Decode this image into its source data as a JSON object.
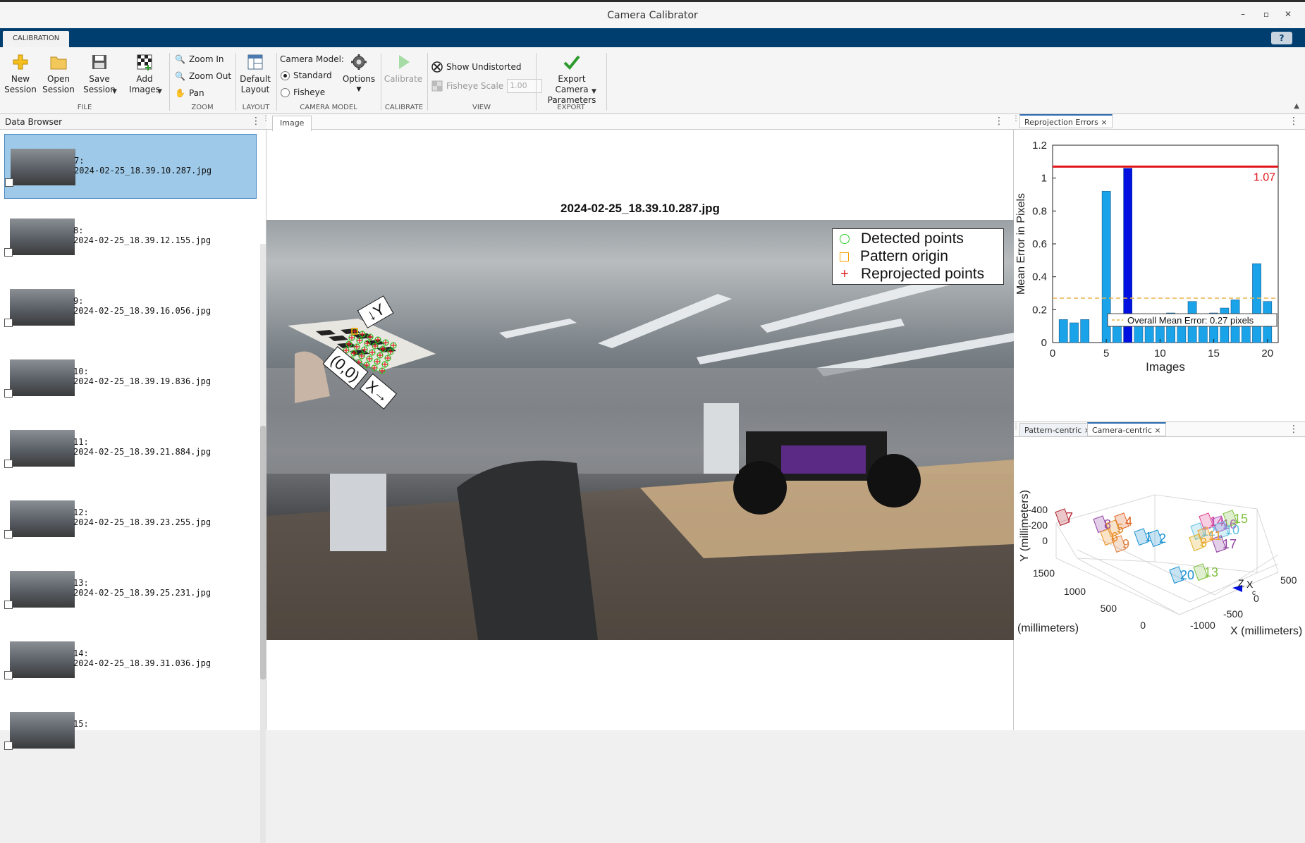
{
  "window": {
    "title": "Camera Calibrator",
    "min": "–",
    "restore": "▫",
    "close": "✕"
  },
  "ribbon": {
    "tab": "CALIBRATION",
    "help": "?",
    "file": {
      "label": "FILE",
      "new": "New\nSession",
      "open": "Open\nSession",
      "save": "Save\nSession",
      "add": "Add\nImages"
    },
    "zoom": {
      "label": "ZOOM",
      "zoom_in": "Zoom In",
      "zoom_out": "Zoom Out",
      "pan": "Pan"
    },
    "layout": {
      "label": "LAYOUT",
      "default": "Default\nLayout"
    },
    "camera_model": {
      "label": "CAMERA MODEL",
      "title": "Camera Model:",
      "standard": "Standard",
      "fisheye": "Fisheye",
      "options": "Options",
      "selected": "Standard"
    },
    "calibrate": {
      "label": "CALIBRATE",
      "button": "Calibrate"
    },
    "view": {
      "label": "VIEW",
      "show_undistorted": "Show Undistorted",
      "fisheye_scale": "Fisheye Scale",
      "fisheye_scale_value": "1.00"
    },
    "export": {
      "label": "EXPORT",
      "button": "Export Camera\nParameters"
    }
  },
  "data_browser": {
    "title": "Data Browser",
    "items": [
      {
        "index": "7:",
        "file": "2024-02-25_18.39.10.287.jpg",
        "selected": true
      },
      {
        "index": "8:",
        "file": "2024-02-25_18.39.12.155.jpg"
      },
      {
        "index": "9:",
        "file": "2024-02-25_18.39.16.056.jpg"
      },
      {
        "index": "10:",
        "file": "2024-02-25_18.39.19.836.jpg"
      },
      {
        "index": "11:",
        "file": "2024-02-25_18.39.21.884.jpg"
      },
      {
        "index": "12:",
        "file": "2024-02-25_18.39.23.255.jpg"
      },
      {
        "index": "13:",
        "file": "2024-02-25_18.39.25.231.jpg"
      },
      {
        "index": "14:",
        "file": "2024-02-25_18.39.31.036.jpg"
      },
      {
        "index": "15:",
        "file": ""
      }
    ]
  },
  "image_panel": {
    "tab": "Image",
    "title": "2024-02-25_18.39.10.287.jpg",
    "legend": {
      "detected": "Detected points",
      "origin": "Pattern origin",
      "reprojected": "Reprojected points"
    },
    "labels": {
      "y_axis": "↓Y",
      "origin": "(0,0)",
      "x_axis": "X→"
    }
  },
  "reprojection": {
    "tab": "Reprojection Errors",
    "close": "×"
  },
  "extrinsics": {
    "tabs": [
      {
        "label": "Pattern-centric",
        "close": "×"
      },
      {
        "label": "Camera-centric",
        "close": "×"
      }
    ],
    "active": "Camera-centric",
    "ylabel": "Y (millimeters)",
    "zlabel": "(millimeters)",
    "xlabel": "X (millimeters)",
    "y_ticks": [
      "-400",
      "-200",
      "0"
    ],
    "z_ticks": [
      "1500",
      "1000",
      "500",
      "0"
    ],
    "x_ticks": [
      "-1000",
      "-500",
      "0",
      "500"
    ],
    "board_labels": [
      "7",
      "8",
      "4",
      "5",
      "1",
      "2",
      "6",
      "9",
      "12",
      "14",
      "16",
      "15",
      "10",
      "3",
      "17",
      "20",
      "13",
      "11"
    ],
    "cam_label_z": "Z",
    "cam_label_x": "X",
    "cam_label_c": "c"
  },
  "chart_data": {
    "type": "bar",
    "ylabel": "Mean Error in Pixels",
    "xlabel": "Images",
    "x_ticks": [
      "0",
      "5",
      "10",
      "15",
      "20"
    ],
    "y_ticks": [
      "0",
      "0.2",
      "0.4",
      "0.6",
      "0.8",
      "1",
      "1.2"
    ],
    "ylim": [
      0,
      1.2
    ],
    "xlim": [
      0,
      21
    ],
    "categories": [
      "1",
      "2",
      "3",
      "4",
      "5",
      "6",
      "7",
      "8",
      "9",
      "10",
      "11",
      "12",
      "13",
      "14",
      "15",
      "16",
      "17",
      "18",
      "19",
      "20"
    ],
    "values": [
      0.14,
      0.12,
      0.14,
      0.0,
      0.92,
      0.12,
      1.06,
      0.12,
      0.17,
      0.16,
      0.18,
      0.16,
      0.25,
      0.15,
      0.18,
      0.21,
      0.26,
      0.11,
      0.48,
      0.25
    ],
    "highlighted_index": 7,
    "bar_color": "#1aa3e8",
    "highlight_color": "#0010e0",
    "threshold_value": 1.07,
    "threshold_label": "1.07",
    "threshold_color": "#e0161b",
    "mean_value": 0.27,
    "mean_label": "Overall Mean Error: 0.27 pixels",
    "mean_color": "#e8b44a"
  }
}
